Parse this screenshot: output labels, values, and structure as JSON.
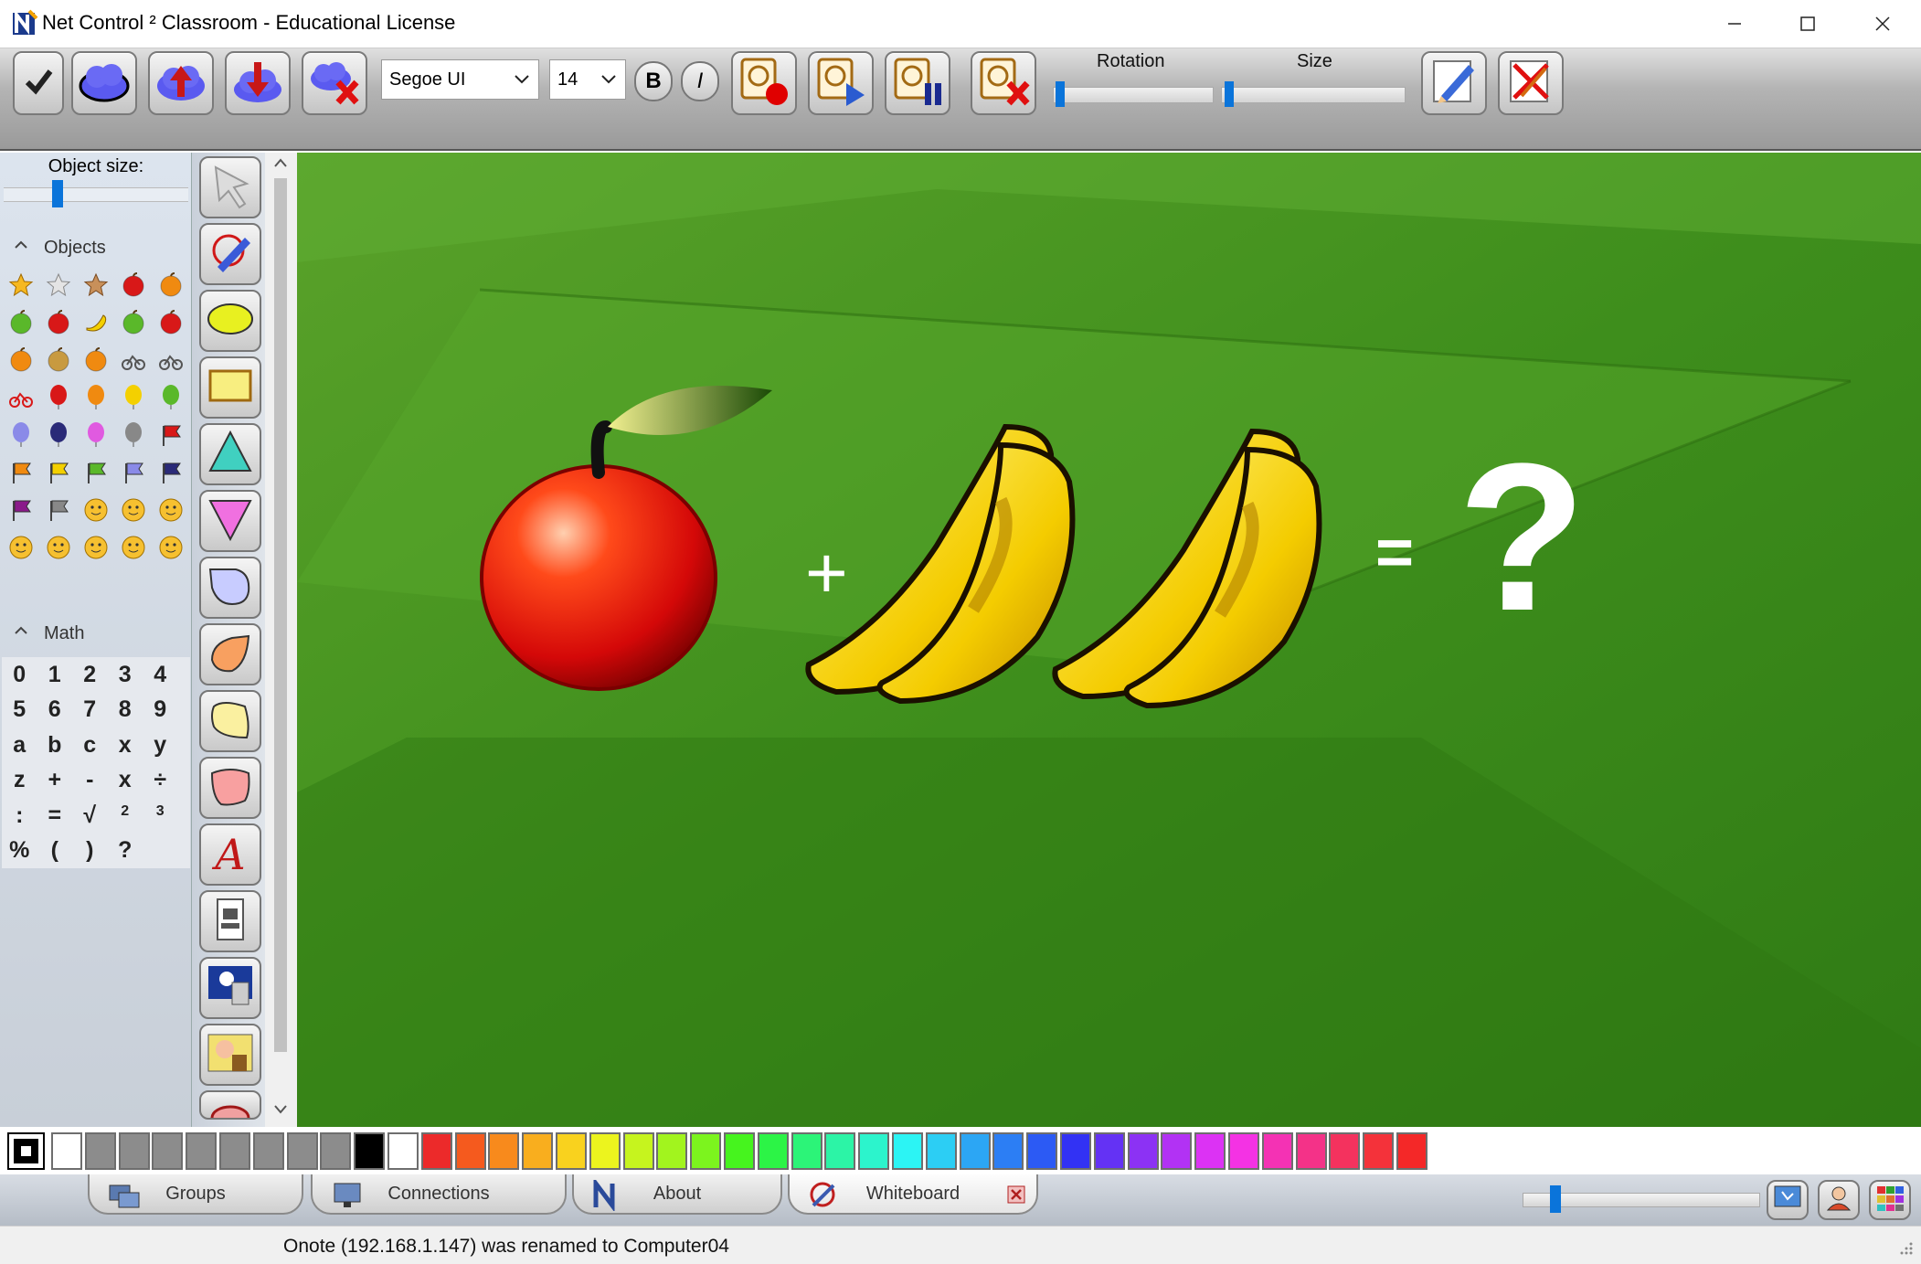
{
  "window": {
    "title": "Net Control ² Classroom - Educational License",
    "controls": [
      "minimize",
      "maximize",
      "close"
    ]
  },
  "toolbar": {
    "buttons": [
      {
        "name": "confirm-button",
        "icon": "checkmark-icon"
      },
      {
        "name": "cloud-button",
        "icon": "cloud-icon"
      },
      {
        "name": "cloud-upload-button",
        "icon": "cloud-upload-icon"
      },
      {
        "name": "cloud-download-button",
        "icon": "cloud-download-icon"
      },
      {
        "name": "cloud-delete-button",
        "icon": "cloud-delete-icon"
      }
    ],
    "font_name": "Segoe UI",
    "font_size": "14",
    "bold_label": "B",
    "italic_label": "I",
    "record_buttons": [
      {
        "name": "record-button",
        "icon": "record-icon"
      },
      {
        "name": "play-button",
        "icon": "play-icon"
      },
      {
        "name": "pause-button",
        "icon": "pause-icon"
      },
      {
        "name": "delete-recording-button",
        "icon": "delete-recording-icon"
      }
    ],
    "rotation_label": "Rotation",
    "size_label": "Size",
    "rotation_value": 0.02,
    "size_value": 0.02,
    "edit_buttons": [
      {
        "name": "edit-button",
        "icon": "pencil-edit-icon"
      },
      {
        "name": "clear-edit-button",
        "icon": "clear-edit-icon"
      }
    ]
  },
  "left_panel": {
    "object_size_label": "Object size:",
    "object_size_value": 0.28,
    "objects_header": "Objects",
    "objects": [
      "star-gold-icon",
      "star-silver-icon",
      "star-bronze-icon",
      "apple-red-icon",
      "apple-orange-icon",
      "apple-green-icon",
      "cherries-icon",
      "banana-icon",
      "watermelon-icon",
      "strawberry-icon",
      "pumpkin-icon",
      "grapes-icon",
      "basketball-icon",
      "bicycle-icon",
      "motorcycle-icon",
      "car-icon",
      "balloon-red-icon",
      "balloon-orange-icon",
      "balloon-yellow-icon",
      "balloon-green-icon",
      "balloon-blue-icon",
      "balloon-navy-icon",
      "balloon-pink-icon",
      "balloon-gray-icon",
      "flag-red-icon",
      "flag-orange-icon",
      "flag-yellow-icon",
      "flag-green-icon",
      "flag-blue-icon",
      "flag-navy-icon",
      "flag-purple-icon",
      "flag-gray-icon",
      "smiley-happy-icon",
      "smiley-neutral-icon",
      "smiley-sad-icon",
      "smiley-wink-icon",
      "smiley-surprised-icon",
      "smiley-content-icon",
      "smiley-grin-icon",
      "smiley-dizzy-icon"
    ],
    "math_header": "Math",
    "math_keys": [
      "0",
      "1",
      "2",
      "3",
      "4",
      "5",
      "6",
      "7",
      "8",
      "9",
      "a",
      "b",
      "c",
      "x",
      "y",
      "z",
      "+",
      "-",
      "x",
      "÷",
      ":",
      "=",
      "√",
      "2",
      "3",
      "%",
      "(",
      ")",
      "?"
    ]
  },
  "tools": [
    "arrow-select-icon",
    "pen-icon",
    "ellipse-icon",
    "rectangle-icon",
    "triangle-up-icon",
    "triangle-down-icon",
    "shape-blue-icon",
    "shape-orange-icon",
    "shape-yellow-icon",
    "shape-pink-icon",
    "text-tool-icon",
    "stamp-icon",
    "teacher-screen-icon",
    "background-image-icon",
    "cloud-more-icon"
  ],
  "canvas": {
    "plus_sign": "+",
    "equals_sign": "=",
    "question_mark": "?"
  },
  "palette": [
    "#ffffff",
    "#8c8c8c",
    "#8c8c8c",
    "#8c8c8c",
    "#8c8c8c",
    "#8c8c8c",
    "#8c8c8c",
    "#8c8c8c",
    "#8c8c8c",
    "#000000",
    "#ffffff",
    "#ec2a2a",
    "#f55a1e",
    "#f88a1c",
    "#f9ae1e",
    "#f9d21e",
    "#ecf41e",
    "#c6f41e",
    "#a2f41e",
    "#7cf41e",
    "#46f41e",
    "#2cf446",
    "#2cf478",
    "#2cf4a6",
    "#2cf4cc",
    "#2cf4f4",
    "#2ccef4",
    "#2ca6f4",
    "#2c7ef4",
    "#2c5af4",
    "#3232f4",
    "#6432f4",
    "#8c32f4",
    "#b232f4",
    "#dc32f4",
    "#f432e4",
    "#f432b4",
    "#f43288",
    "#f4325e",
    "#f4323a",
    "#f42828"
  ],
  "tabs": [
    {
      "label": "Groups",
      "icon": "groups-icon"
    },
    {
      "label": "Connections",
      "icon": "connections-icon"
    },
    {
      "label": "About",
      "icon": "about-logo-icon"
    },
    {
      "label": "Whiteboard",
      "icon": "whiteboard-icon"
    }
  ],
  "zoom_value": 0.12,
  "status_text": "Onote (192.168.1.147) was renamed to Computer04"
}
